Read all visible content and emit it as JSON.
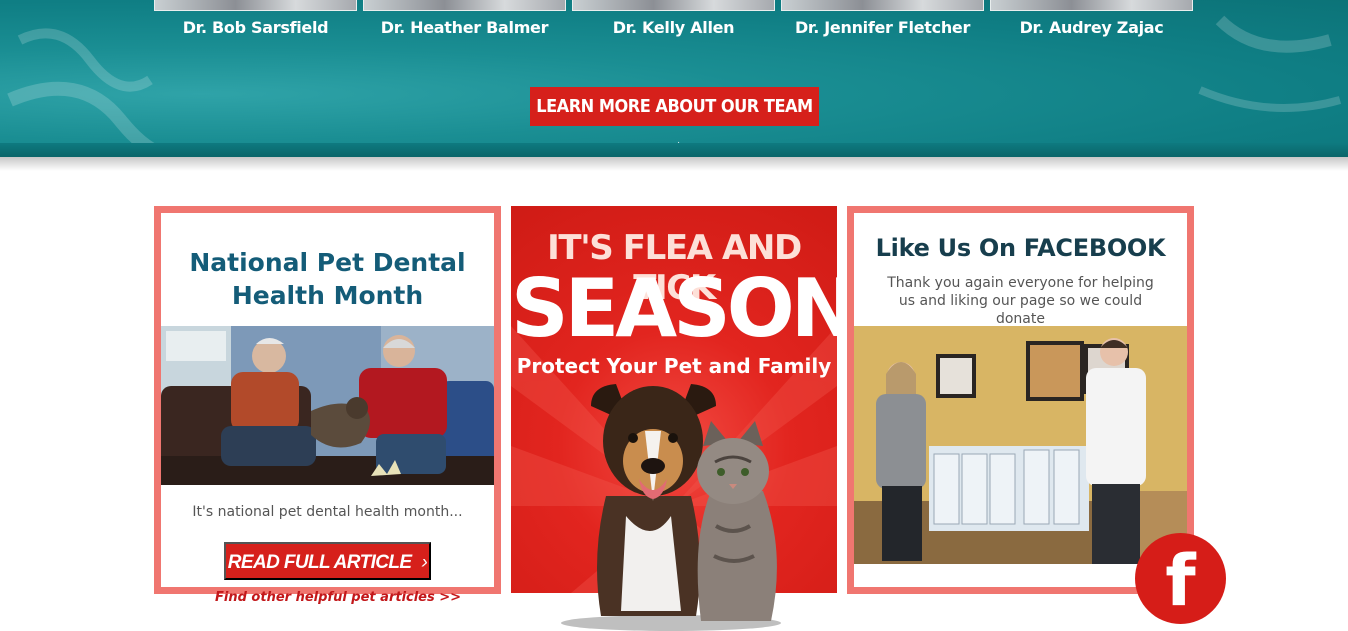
{
  "team": {
    "doctors": [
      {
        "name": "Dr. Bob Sarsfield"
      },
      {
        "name": "Dr. Heather Balmer"
      },
      {
        "name": "Dr. Kelly Allen"
      },
      {
        "name": "Dr. Jennifer Fletcher"
      },
      {
        "name": "Dr. Audrey Zajac"
      }
    ],
    "button_label": "LEARN MORE ABOUT OUR TEAM"
  },
  "dental": {
    "title": "National Pet Dental Health Month",
    "excerpt": "It's national pet dental health month...",
    "button_label": "READ FULL ARTICLE",
    "link_label": "Find other helpful pet articles >>"
  },
  "flea": {
    "line1": "IT'S FLEA AND TICK",
    "line2": "SEASON",
    "line3": "Protect Your Pet and Family"
  },
  "facebook": {
    "title": "Like Us On FACEBOOK",
    "text": "Thank you again everyone for helping us and liking our page so we could donate",
    "icon_letter": "f"
  },
  "colors": {
    "teal": "#137f85",
    "red": "#d6201b",
    "card_border": "#f07670",
    "dental_title": "#145c78",
    "facebook_title": "#173e4d"
  },
  "icons": {
    "chevron": "chevron-right-icon",
    "facebook": "facebook-icon"
  }
}
